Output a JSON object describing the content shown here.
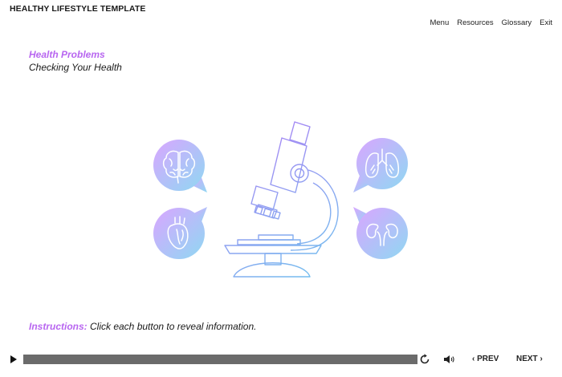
{
  "header": {
    "course_title": "HEALTHY LIFESTYLE TEMPLATE",
    "nav": {
      "menu": "Menu",
      "resources": "Resources",
      "glossary": "Glossary",
      "exit": "Exit"
    }
  },
  "content": {
    "heading": "Health Problems",
    "subheading": "Checking Your Health",
    "buttons": [
      {
        "id": "brain",
        "icon": "brain-icon"
      },
      {
        "id": "lungs",
        "icon": "lungs-icon"
      },
      {
        "id": "heart",
        "icon": "heart-icon"
      },
      {
        "id": "kidneys",
        "icon": "kidneys-icon"
      }
    ],
    "illustration": "microscope-icon",
    "instructions_label": "Instructions:",
    "instructions_text": " Click each button to reveal information."
  },
  "player": {
    "progress": 1.0,
    "prev_label": "PREV",
    "next_label": "NEXT",
    "prev_arrow": "‹",
    "next_arrow": "›"
  },
  "colors": {
    "accent": "#b866f0",
    "gradient_start": "#d9a6ff",
    "gradient_end": "#8fd8f2",
    "outline_start": "#b07cf5",
    "outline_end": "#6fc3ee",
    "progress_fill": "#6b6b6b",
    "progress_track": "#cfcfcf"
  }
}
